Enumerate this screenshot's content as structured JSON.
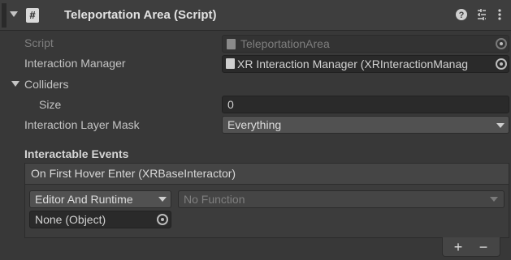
{
  "header": {
    "title": "Teleportation Area (Script)",
    "icons": [
      "help-icon",
      "preset-icon",
      "context-menu-icon"
    ]
  },
  "fields": {
    "script_label": "Script",
    "script_value": "TeleportationArea",
    "interaction_manager_label": "Interaction Manager",
    "interaction_manager_value": "XR Interaction Manager (XRInteractionManag",
    "colliders_label": "Colliders",
    "size_label": "Size",
    "size_value": "0",
    "layer_mask_label": "Interaction Layer Mask",
    "layer_mask_value": "Everything"
  },
  "events": {
    "section_title": "Interactable Events",
    "event_name": "On First Hover Enter (XRBaseInteractor)",
    "runtime_mode": "Editor And Runtime",
    "function": "No Function",
    "target_object": "None (Object)",
    "add_label": "+",
    "remove_label": "−"
  }
}
